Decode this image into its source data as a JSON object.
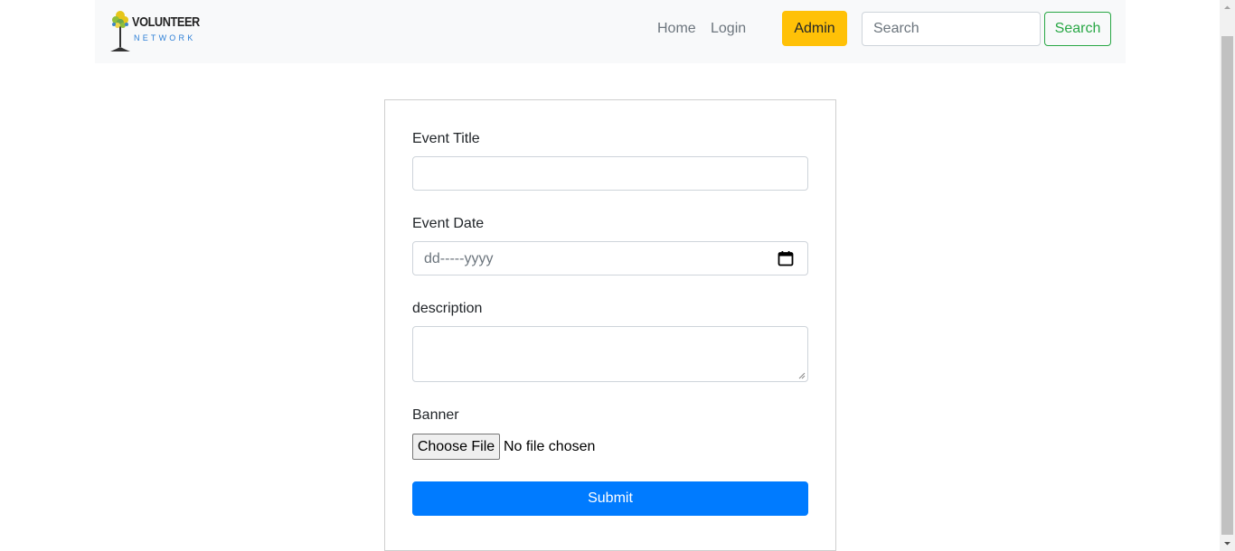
{
  "navbar": {
    "brand": {
      "main": "VOLUNTEER",
      "sub": "NETWORK",
      "icon": "tree-logo"
    },
    "links": [
      {
        "label": "Home"
      },
      {
        "label": "Login"
      }
    ],
    "admin_label": "Admin",
    "search": {
      "placeholder": "Search",
      "value": "",
      "button_label": "Search"
    }
  },
  "form": {
    "title_label": "Event Title",
    "title_value": "",
    "date_label": "Event Date",
    "date_placeholder": "dd-----yyyy",
    "date_icon": "calendar-icon",
    "description_label": "description",
    "description_value": "",
    "banner_label": "Banner",
    "file_button_label": "Choose File",
    "file_status": "No file chosen",
    "submit_label": "Submit"
  },
  "colors": {
    "admin": "#ffc107",
    "search_outline": "#28a745",
    "submit": "#007bff",
    "navbar_bg": "#f8f9fa"
  }
}
